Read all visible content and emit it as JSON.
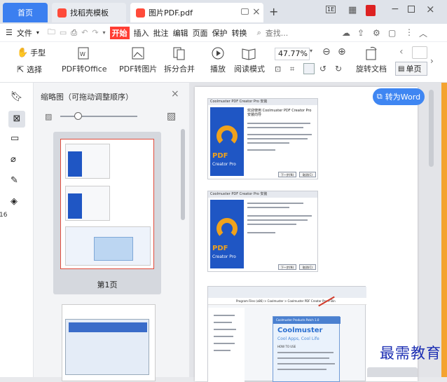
{
  "tabs": {
    "home": "首页",
    "template": "找稻壳模板",
    "pdf": "图片PDF.pdf",
    "page_badge": "1E"
  },
  "menu": {
    "file": "文件",
    "start": "开始",
    "insert": "插入",
    "annotate": "批注",
    "edit": "编辑",
    "page": "页面",
    "protect": "保护",
    "convert": "转换",
    "search": "查找..."
  },
  "ribbon": {
    "hand": "手型",
    "select": "选择",
    "pdf_office": "PDF转Office",
    "pdf_image": "PDF转图片",
    "split_merge": "拆分合并",
    "play": "播放",
    "read_mode": "阅读模式",
    "zoom": "47.77%",
    "rotate": "旋转文档",
    "single": "单页"
  },
  "thumbs": {
    "title": "缩略图（可拖动调整顺序）",
    "page1": "第1页"
  },
  "doc": {
    "convert_word": "转为Word",
    "shot1_title": "Coolmuster PDF Creator Pro 安装",
    "shot2_title": "Coolmuster PDF Creator Pro 安装",
    "welcome1": "欢迎使用 Coolmuster PDF Creator Pro 安装向导",
    "pdf": "PDF",
    "creator": "Creator Pro",
    "next": "下一步(N)",
    "cancel": "取消(C)",
    "path": "Program Files (x86) > Coolmuster > Coolmuster PDF Creator Pro > Bin",
    "product_title": "Coolmuster Products Patch 1.0",
    "coolmuster": "Coolmuster",
    "tagline": "Cool Apps, Cool Life",
    "how": "HOW TO USE",
    "watermark": "最需教育",
    "page_edge": "16"
  }
}
